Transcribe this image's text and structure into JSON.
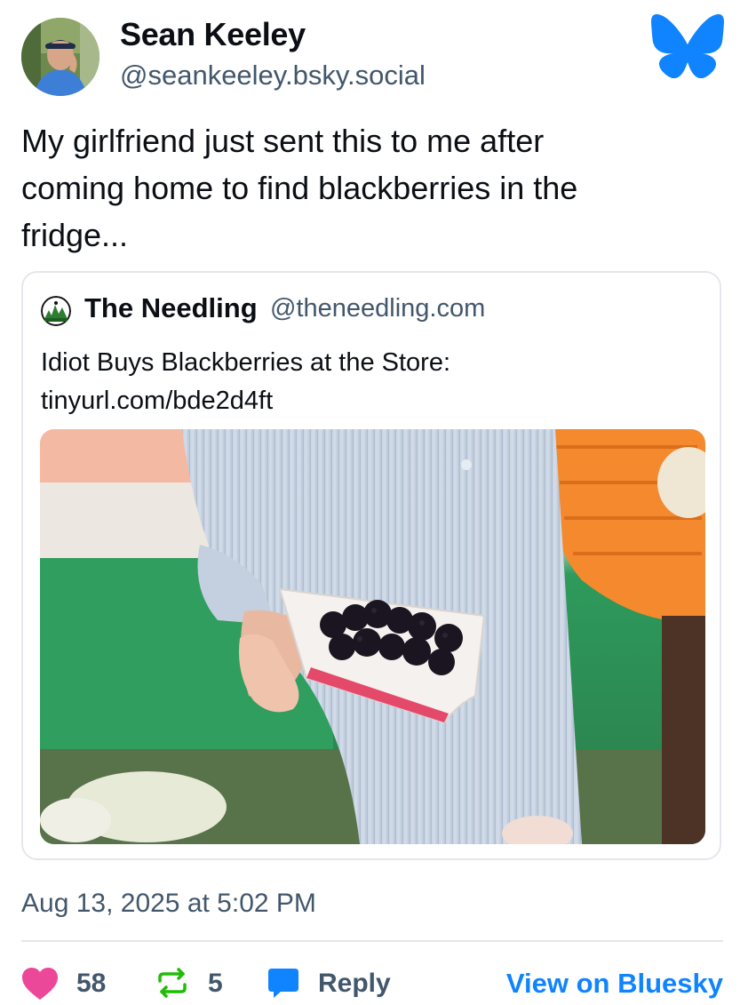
{
  "author": {
    "name": "Sean Keeley",
    "handle": "@seankeeley.bsky.social"
  },
  "post": {
    "lines": [
      "My girlfriend just sent this to me after",
      "coming home to find blackberries in the",
      "fridge..."
    ]
  },
  "quote": {
    "name": "The Needling",
    "handle": "@theneedling.com",
    "lines": [
      "Idiot Buys Blackberries at the Store:",
      "tinyurl.com/bde2d4ft"
    ]
  },
  "timestamp": "Aug 13, 2025 at 5:02 PM",
  "actions": {
    "likes": "58",
    "reposts": "5",
    "reply_label": "Reply",
    "view_label": "View on Bluesky"
  },
  "colors": {
    "brand": "#1083fe",
    "like": "#ec4899",
    "repost": "#20bc07",
    "muted": "#42576c"
  },
  "icons": [
    "bluesky-butterfly-icon",
    "heart-icon",
    "repost-icon",
    "reply-bubble-icon"
  ]
}
